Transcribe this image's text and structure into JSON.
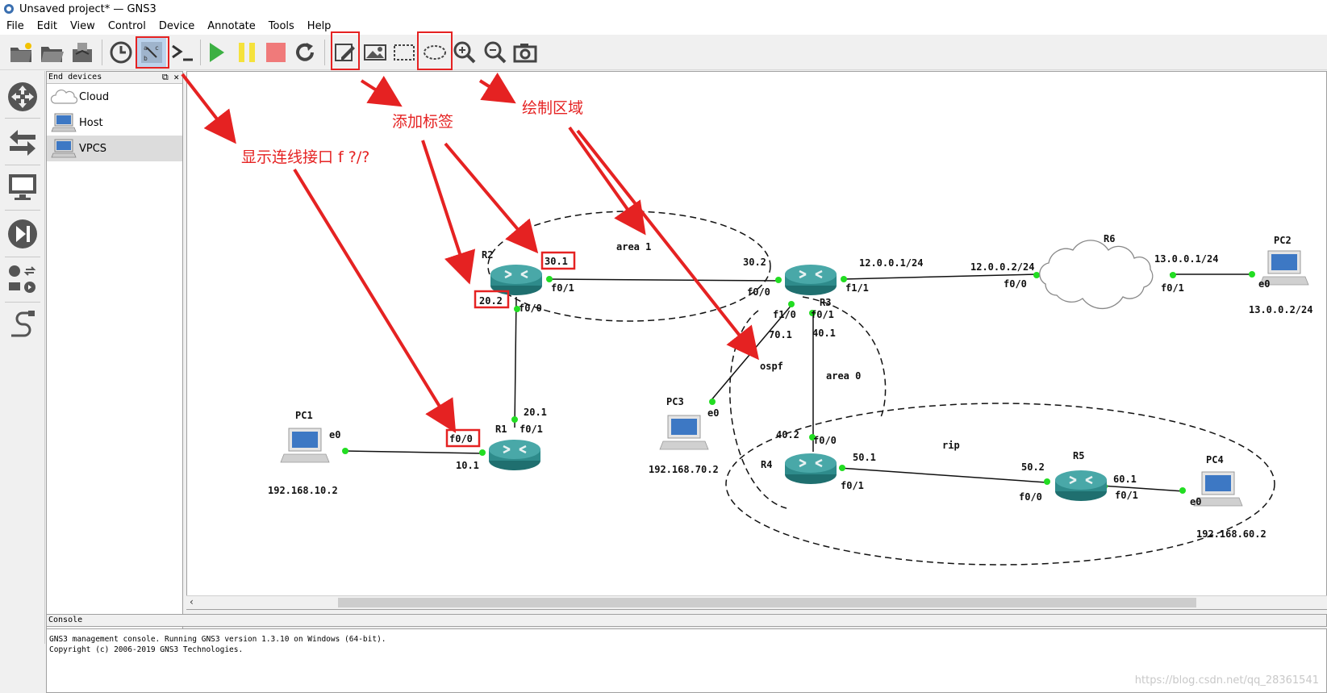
{
  "window": {
    "title": "Unsaved project* — GNS3"
  },
  "menu": [
    "File",
    "Edit",
    "View",
    "Control",
    "Device",
    "Annotate",
    "Tools",
    "Help"
  ],
  "panel": {
    "title": "End devices",
    "devices": [
      {
        "label": "Cloud",
        "icon": "cloud-icon"
      },
      {
        "label": "Host",
        "icon": "host-icon"
      },
      {
        "label": "VPCS",
        "icon": "vpcs-icon"
      }
    ]
  },
  "console": {
    "title": "Console",
    "lines": [
      "GNS3 management console. Running GNS3 version 1.3.10 on Windows (64-bit).",
      "Copyright (c) 2006-2019 GNS3 Technologies."
    ]
  },
  "watermark": "https://blog.csdn.net/qq_28361541",
  "annotations": {
    "show_interfaces": "显示连线接口 f ?/?",
    "add_label": "添加标签",
    "draw_area": "绘制区域"
  },
  "devices": {
    "R1": "R1",
    "R2": "R2",
    "R3": "R3",
    "R4": "R4",
    "R5": "R5",
    "R6": "R6",
    "PC1": "PC1",
    "PC2": "PC2",
    "PC3": "PC3",
    "PC4": "PC4"
  },
  "areas": {
    "area1": "area 1",
    "area0": "area 0",
    "ospf": "ospf",
    "rip": "rip"
  },
  "labels": {
    "r2_30_1": "30.1",
    "r2_20_2": "20.2",
    "r2_f0_1": "f0/1",
    "r2_f0_0": "f0/0",
    "r3_30_2": "30.2",
    "r3_f0_0": "f0/0",
    "r3_f1_1": "f1/1",
    "r3_f1_0": "f1/0",
    "r3_f0_1": "f0/1",
    "r3_70_1": "70.1",
    "r3_40_1": "40.1",
    "r3_12_0_0_1": "12.0.0.1/24",
    "r6_12_0_0_2": "12.0.0.2/24",
    "r6_f0_0": "f0/0",
    "r6_13_0_0_1": "13.0.0.1/24",
    "r6_f0_1": "f0/1",
    "pc2_e0": "e0",
    "pc2_ip": "13.0.0.2/24",
    "r1_f0_0": "f0/0",
    "r1_20_1": "20.1",
    "r1_f0_1": "f0/1",
    "r1_10_1": "10.1",
    "pc1_e0": "e0",
    "pc1_ip": "192.168.10.2",
    "pc3_e0": "e0",
    "pc3_ip": "192.168.70.2",
    "r4_40_2": "40.2",
    "r4_f0_0": "f0/0",
    "r4_50_1": "50.1",
    "r4_f0_1": "f0/1",
    "r5_50_2": "50.2",
    "r5_f0_0": "f0/0",
    "r5_60_1": "60.1",
    "r5_f0_1": "f0/1",
    "pc4_e0": "e0",
    "pc4_ip": "192.168.60.2"
  },
  "colors": {
    "annotation_red": "#e52222",
    "router": "#2e8b8b",
    "link_dot": "#22dd22"
  }
}
